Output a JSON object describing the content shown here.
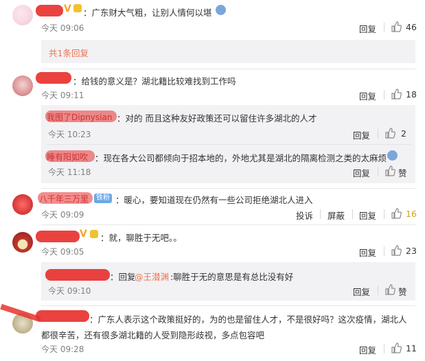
{
  "colors": {
    "accent": "#eb7350",
    "redaction": "#e8322f",
    "sub_bg": "#f2f2f5",
    "gold_like": "#d4a017"
  },
  "comments": [
    {
      "text": "：广东财大气粗，让别人情何以堪",
      "time": "今天 09:06",
      "reply": "回复",
      "likes": "46"
    },
    {
      "text": "：给钱的意义是？湖北籍比较难找到工作吗",
      "time": "今天 09:11",
      "reply": "回复",
      "likes": "18"
    },
    {
      "name_partial": "八千年三万里",
      "badge": "铁粉",
      "text": "：暖心，要知道现在仍然有一些公司拒绝湖北人进入",
      "time": "今天 09:09",
      "report": "投诉",
      "block": "屏蔽",
      "reply": "回复",
      "likes": "16"
    },
    {
      "text": "：就，聊胜于无吧。。",
      "time": "今天 09:05",
      "reply": "回复",
      "likes": "23"
    },
    {
      "text_line1": "：广东人表示这个政策挺好的，为的也是留住人才，不是很好吗？这次疫情，湖北人",
      "text_line2": "都很辛苦，还有很多湖北籍的人受到隐形歧视，多点包容吧",
      "time": "今天 09:28",
      "reply": "回复",
      "likes": "11"
    }
  ],
  "subs": [
    {
      "more": "共1条回复"
    },
    {
      "name_partial": "我图了Dipnysian",
      "text": "：对的 而且这种友好政策还可以留住许多湖北的人才",
      "time": "今天 10:23",
      "reply": "回复",
      "likes": "2"
    },
    {
      "name_partial": "睡有阳如吹",
      "text": "：现在各大公司都倾向于招本地的，外地尤其是湖北的隔离检测之类的太麻烦",
      "time": "今天 11:18",
      "reply": "回复",
      "likes": "赞"
    },
    {
      "reply_prefix": "：回复",
      "mention": "@王潜渊",
      "text": ":聊胜于无的意思是有总比没有好",
      "time": "今天 09:10",
      "reply": "回复",
      "likes": "赞"
    }
  ]
}
